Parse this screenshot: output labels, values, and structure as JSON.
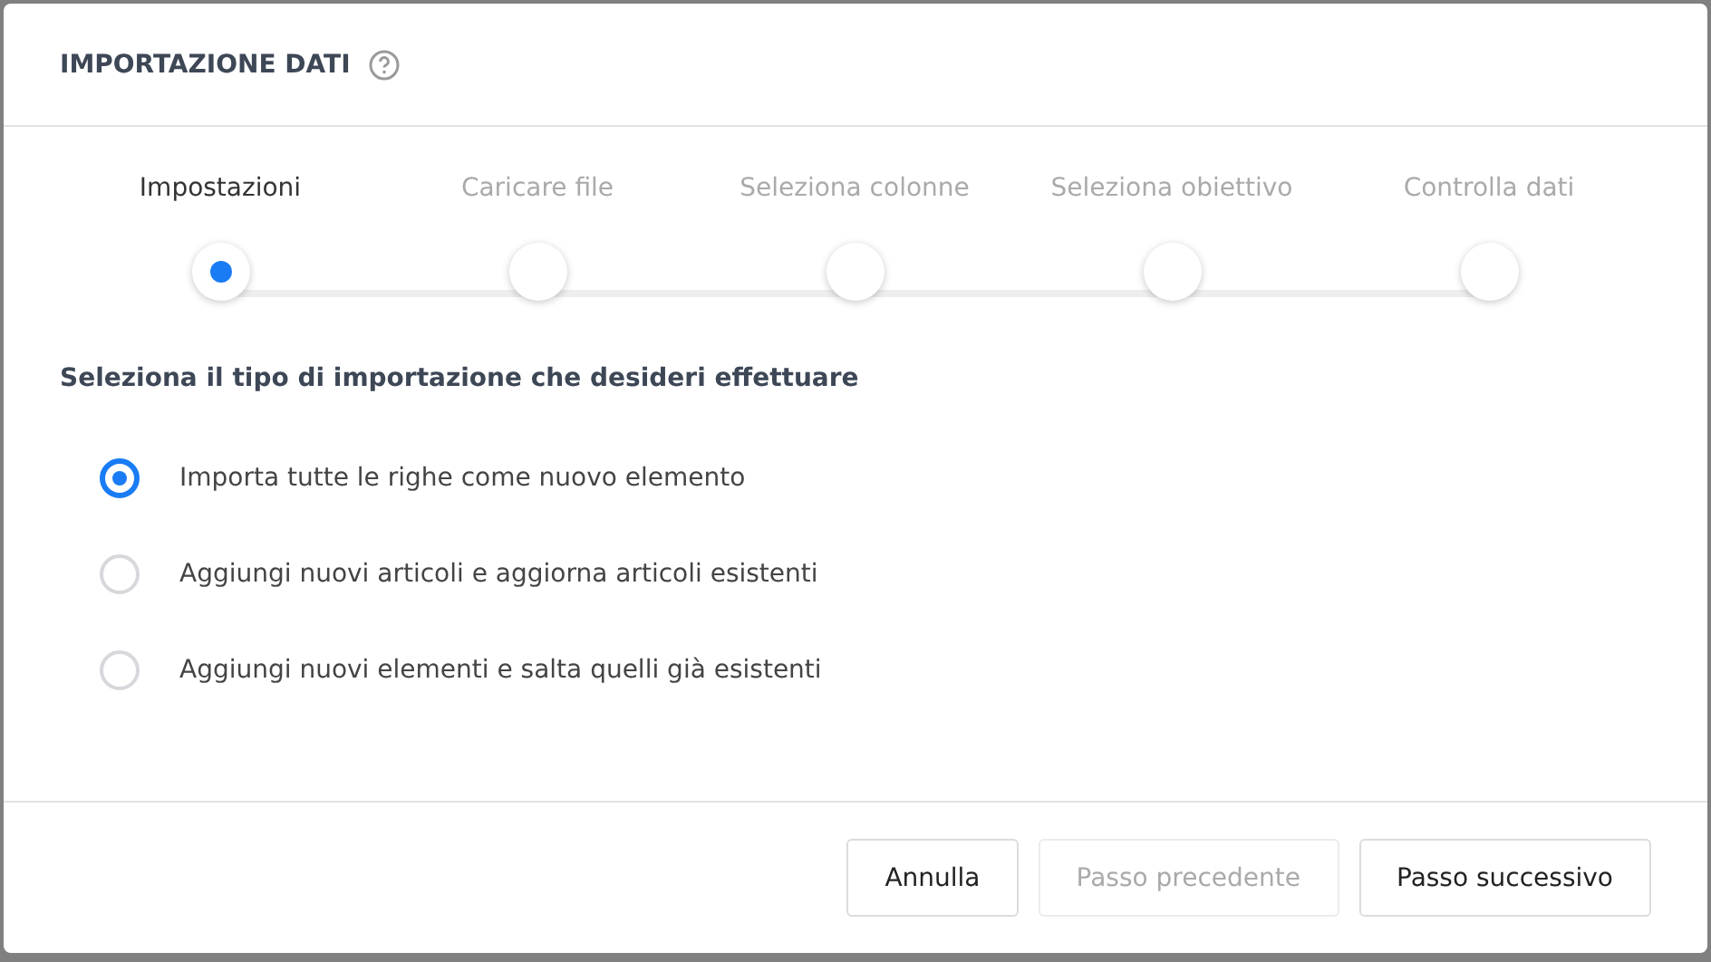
{
  "dialog": {
    "title": "IMPORTAZIONE DATI"
  },
  "steps": [
    {
      "label": "Impostazioni",
      "selected": true
    },
    {
      "label": "Caricare file",
      "selected": false
    },
    {
      "label": "Seleziona colonne",
      "selected": false
    },
    {
      "label": "Seleziona obiettivo",
      "selected": false
    },
    {
      "label": "Controlla dati",
      "selected": false
    }
  ],
  "question": "Seleziona il tipo di importazione che desideri effettuare",
  "options": [
    {
      "label": "Importa tutte le righe come nuovo elemento",
      "selected": true
    },
    {
      "label": "Aggiungi nuovi articoli e aggiorna articoli esistenti",
      "selected": false
    },
    {
      "label": "Aggiungi nuovi elementi e salta quelli già esistenti",
      "selected": false
    }
  ],
  "buttons": [
    {
      "label": "Annulla",
      "disabled": false
    },
    {
      "label": "Passo precedente",
      "disabled": true
    },
    {
      "label": "Passo successivo",
      "disabled": false
    }
  ]
}
